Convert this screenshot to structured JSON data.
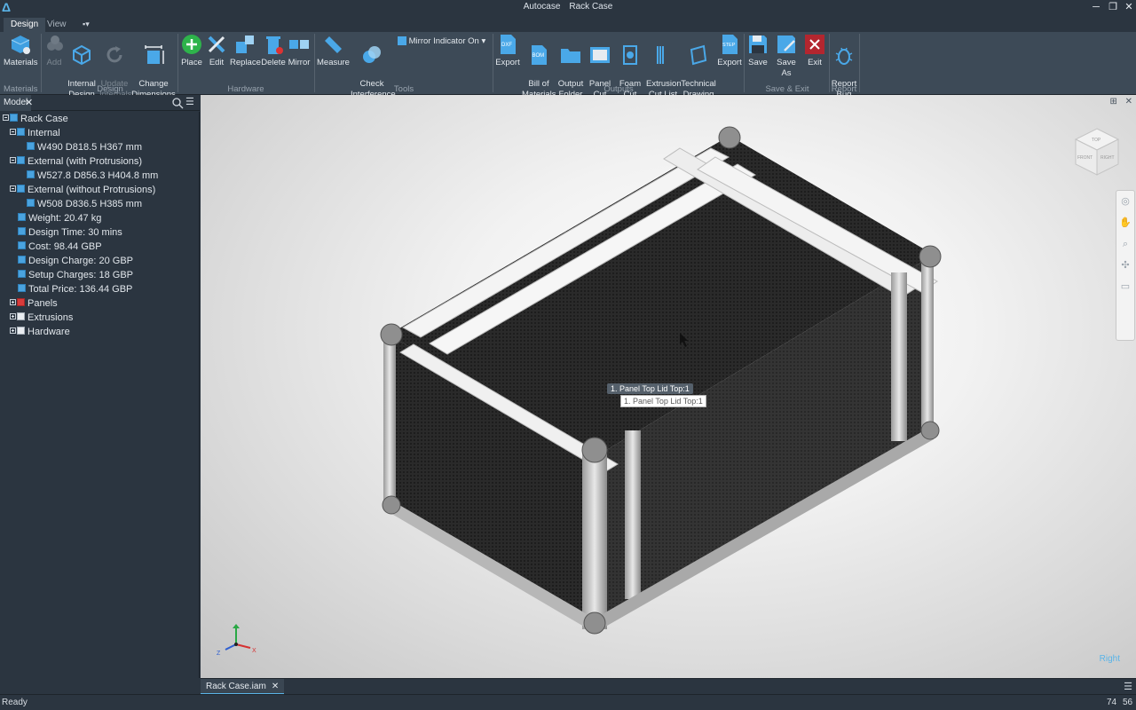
{
  "titlebar": {
    "app": "Autocase",
    "document": "Rack Case"
  },
  "ribbon_tabs": [
    "Design",
    "View"
  ],
  "ribbon": {
    "materials": "Materials",
    "add": "Add",
    "internal_design": "Internal\nDesign",
    "update_internals": "Update\nInternals",
    "change_dimensions": "Change\nDimensions",
    "place": "Place",
    "edit": "Edit",
    "replace": "Replace",
    "delete": "Delete",
    "mirror": "Mirror",
    "measure": "Measure",
    "check_interference": "Check\nInterference",
    "mirror_indicator": "Mirror Indicator On",
    "export_dxf": "Export",
    "bill_of_materials": "Bill of\nMaterials",
    "output_folder": "Output\nFolder",
    "panel_cut_list": "Panel\nCut List",
    "foam_cut_list": "Foam\nCut List",
    "extrusion_cut_list": "Extrusion\nCut List",
    "technical_drawing": "Technical\nDrawing",
    "export_step": "Export",
    "save": "Save",
    "save_as": "Save As",
    "exit": "Exit",
    "report_bug": "Report\nBug",
    "icon_text": {
      "dxf": "DXF",
      "bom": "BOM",
      "step": "STEP"
    },
    "groups": {
      "materials": "Materials",
      "design": "Design",
      "hardware": "Hardware",
      "tools": "Tools",
      "outputs": "Outputs",
      "save_exit": "Save & Exit",
      "report": "Report"
    }
  },
  "panel": {
    "tab": "Model"
  },
  "tree": {
    "root": "Rack Case",
    "internal": "Internal",
    "internal_dims": "W490 D818.5 H367 mm",
    "external_with": "External (with Protrusions)",
    "external_with_dims": "W527.8 D856.3 H404.8 mm",
    "external_without": "External (without Protrusions)",
    "external_without_dims": "W508 D836.5 H385 mm",
    "weight": "Weight: 20.47 kg",
    "design_time": "Design Time: 30 mins",
    "cost": "Cost: 98.44 GBP",
    "design_charge": "Design Charge: 20 GBP",
    "setup_charges": "Setup Charges: 18 GBP",
    "total_price": "Total Price: 136.44 GBP",
    "panels": "Panels",
    "extrusions": "Extrusions",
    "hardware": "Hardware"
  },
  "viewport": {
    "tooltip_chip": "1. Panel Top Lid Top:1",
    "tooltip_box": "1. Panel Top Lid Top:1",
    "viewcube_top": "TOP",
    "viewcube_front": "FRONT",
    "viewcube_right": "RIGHT",
    "orientation_label": "Right",
    "axis_x": "X",
    "axis_z": "Z"
  },
  "doc_tab": "Rack Case.iam",
  "status": {
    "text": "Ready",
    "num1": "74",
    "num2": "56"
  },
  "colors": {
    "accent": "#5ab4e8",
    "ribbon_bg": "#3d4a57",
    "panel_bg": "#2b3540",
    "exit_red": "#b3262f"
  }
}
